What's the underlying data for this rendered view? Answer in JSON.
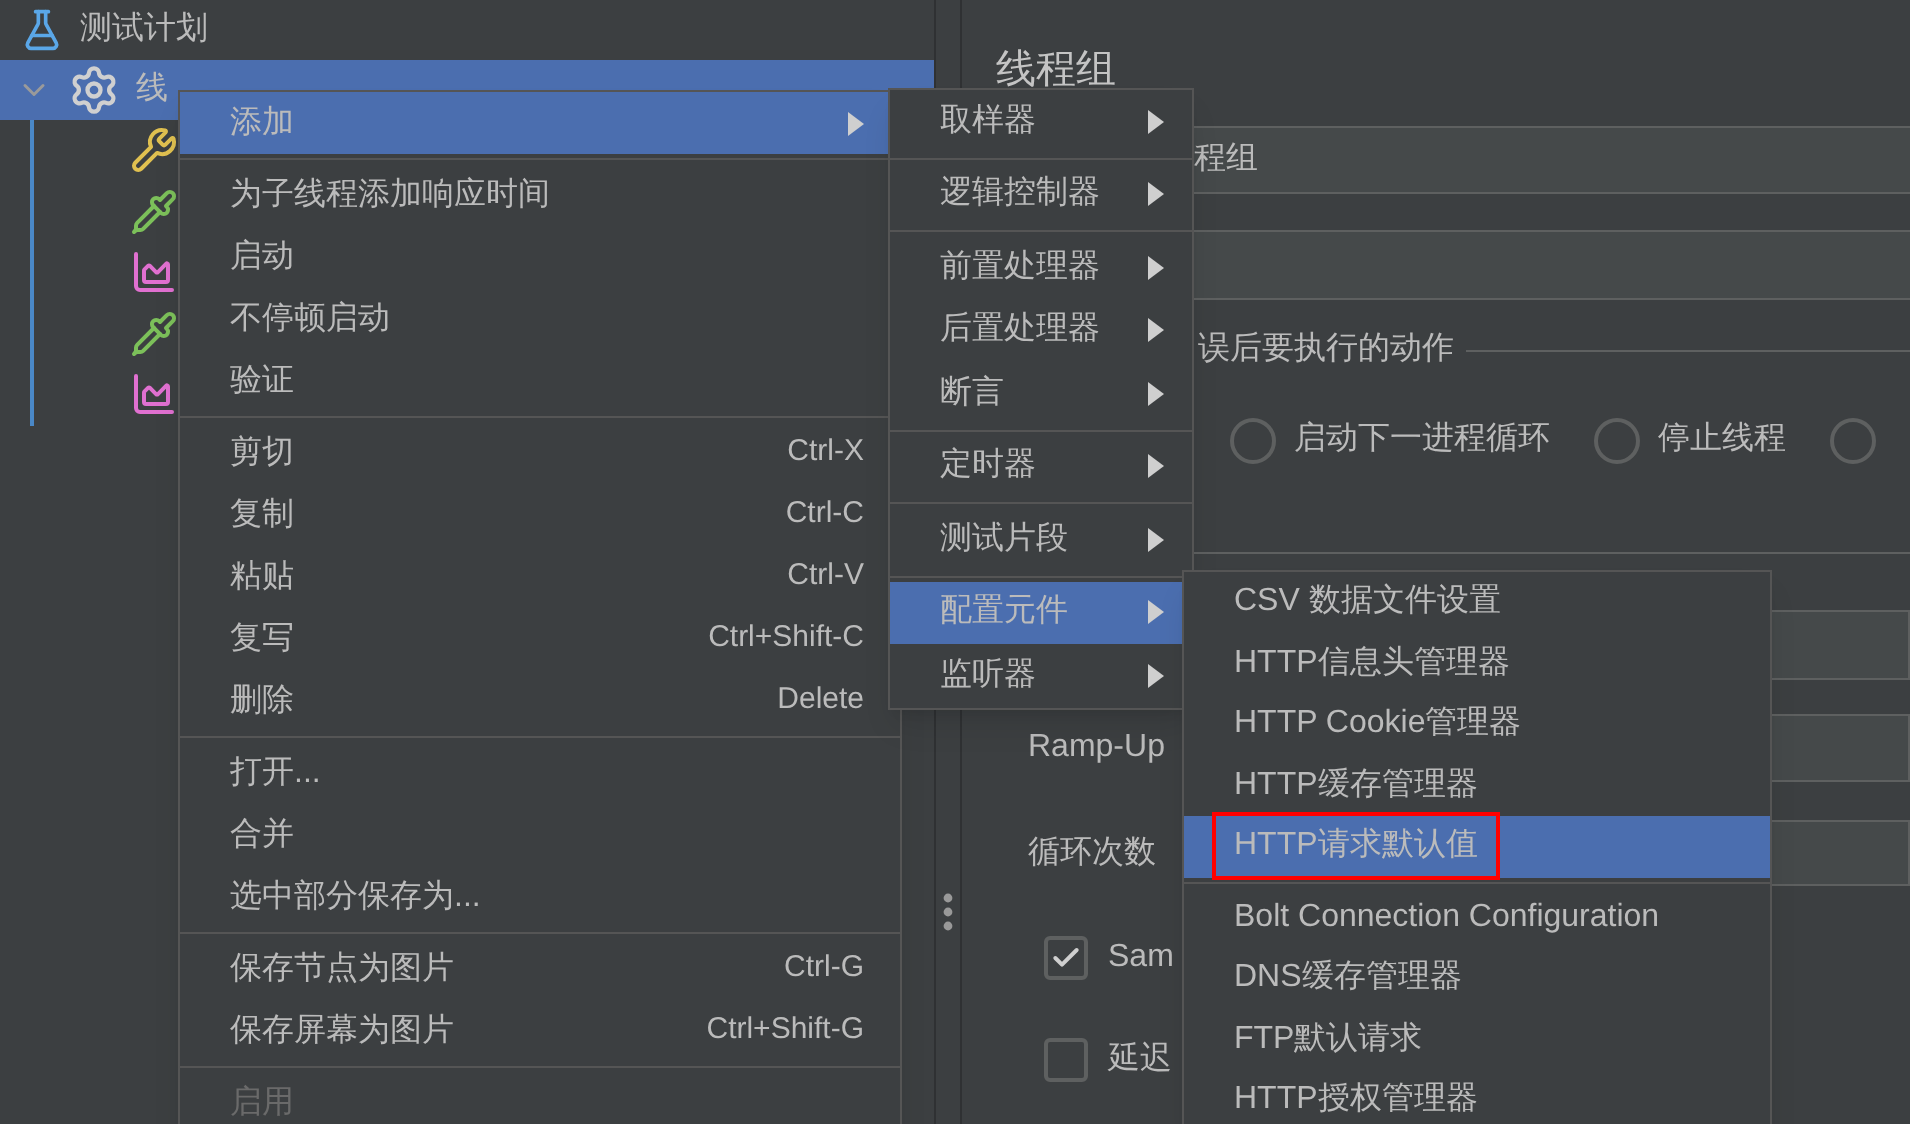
{
  "tree": {
    "items": [
      {
        "kind": "plan",
        "label": "测试计划",
        "selected": false
      },
      {
        "kind": "thread-group",
        "label": "线",
        "selected": true,
        "expanded": true,
        "children": [
          {
            "kind": "tools"
          },
          {
            "kind": "dropper"
          },
          {
            "kind": "chart"
          },
          {
            "kind": "dropper"
          },
          {
            "kind": "chart"
          }
        ]
      }
    ]
  },
  "context_menu": {
    "items": [
      {
        "kind": "item",
        "label": "添加",
        "submenu": true,
        "selected": true,
        "disabled": false
      },
      {
        "kind": "separator"
      },
      {
        "kind": "item",
        "label": "为子线程添加响应时间",
        "selected": false,
        "disabled": false
      },
      {
        "kind": "item",
        "label": "启动",
        "selected": false,
        "disabled": false
      },
      {
        "kind": "item",
        "label": "不停顿启动",
        "selected": false,
        "disabled": false
      },
      {
        "kind": "item",
        "label": "验证",
        "selected": false,
        "disabled": false
      },
      {
        "kind": "separator"
      },
      {
        "kind": "item",
        "label": "剪切",
        "shortcut": "Ctrl-X",
        "selected": false,
        "disabled": false
      },
      {
        "kind": "item",
        "label": "复制",
        "shortcut": "Ctrl-C",
        "selected": false,
        "disabled": false
      },
      {
        "kind": "item",
        "label": "粘贴",
        "shortcut": "Ctrl-V",
        "selected": false,
        "disabled": false
      },
      {
        "kind": "item",
        "label": "复写",
        "shortcut": "Ctrl+Shift-C",
        "selected": false,
        "disabled": false
      },
      {
        "kind": "item",
        "label": "删除",
        "shortcut": "Delete",
        "selected": false,
        "disabled": false
      },
      {
        "kind": "separator"
      },
      {
        "kind": "item",
        "label": "打开...",
        "selected": false,
        "disabled": false
      },
      {
        "kind": "item",
        "label": "合并",
        "selected": false,
        "disabled": false
      },
      {
        "kind": "item",
        "label": "选中部分保存为...",
        "selected": false,
        "disabled": false
      },
      {
        "kind": "separator"
      },
      {
        "kind": "item",
        "label": "保存节点为图片",
        "shortcut": "Ctrl-G",
        "selected": false,
        "disabled": false
      },
      {
        "kind": "item",
        "label": "保存屏幕为图片",
        "shortcut": "Ctrl+Shift-G",
        "selected": false,
        "disabled": false
      },
      {
        "kind": "separator"
      },
      {
        "kind": "item",
        "label": "启用",
        "selected": false,
        "disabled": true
      }
    ]
  },
  "add_submenu": {
    "items": [
      {
        "kind": "item",
        "label": "取样器",
        "submenu": true,
        "selected": false
      },
      {
        "kind": "separator"
      },
      {
        "kind": "item",
        "label": "逻辑控制器",
        "submenu": true,
        "selected": false
      },
      {
        "kind": "separator"
      },
      {
        "kind": "item",
        "label": "前置处理器",
        "submenu": true,
        "selected": false
      },
      {
        "kind": "item",
        "label": "后置处理器",
        "submenu": true,
        "selected": false
      },
      {
        "kind": "item",
        "label": "断言",
        "submenu": true,
        "selected": false
      },
      {
        "kind": "separator"
      },
      {
        "kind": "item",
        "label": "定时器",
        "submenu": true,
        "selected": false
      },
      {
        "kind": "separator"
      },
      {
        "kind": "item",
        "label": "测试片段",
        "submenu": true,
        "selected": false
      },
      {
        "kind": "separator"
      },
      {
        "kind": "item",
        "label": "配置元件",
        "submenu": true,
        "selected": true
      },
      {
        "kind": "item",
        "label": "监听器",
        "submenu": true,
        "selected": false
      }
    ]
  },
  "config_submenu": {
    "items": [
      {
        "kind": "item",
        "label": "CSV 数据文件设置",
        "selected": false,
        "outlined": false
      },
      {
        "kind": "item",
        "label": "HTTP信息头管理器",
        "selected": false,
        "outlined": false
      },
      {
        "kind": "item",
        "label": "HTTP Cookie管理器",
        "selected": false,
        "outlined": false
      },
      {
        "kind": "item",
        "label": "HTTP缓存管理器",
        "selected": false,
        "outlined": false
      },
      {
        "kind": "item",
        "label": "HTTP请求默认值",
        "selected": true,
        "outlined": true
      },
      {
        "kind": "separator"
      },
      {
        "kind": "item",
        "label": "Bolt Connection Configuration",
        "selected": false,
        "outlined": false
      },
      {
        "kind": "item",
        "label": "DNS缓存管理器",
        "selected": false,
        "outlined": false
      },
      {
        "kind": "item",
        "label": "FTP默认请求",
        "selected": false,
        "outlined": false
      },
      {
        "kind": "item",
        "label": "HTTP授权管理器",
        "selected": false,
        "outlined": false
      }
    ]
  },
  "panel": {
    "title": "线程组",
    "name_value": "程组",
    "error_action_legend": "误后要执行的动作",
    "radios": [
      {
        "label": "启动下一进程循环",
        "selected": false
      },
      {
        "label": "停止线程",
        "selected": false
      },
      {
        "selected": false
      }
    ],
    "ramp_up_label": "Ramp-Up",
    "loop_label": "循环次数",
    "checkboxes": [
      {
        "label": "Sam",
        "checked": true
      },
      {
        "label": "延迟",
        "checked": false
      }
    ]
  }
}
